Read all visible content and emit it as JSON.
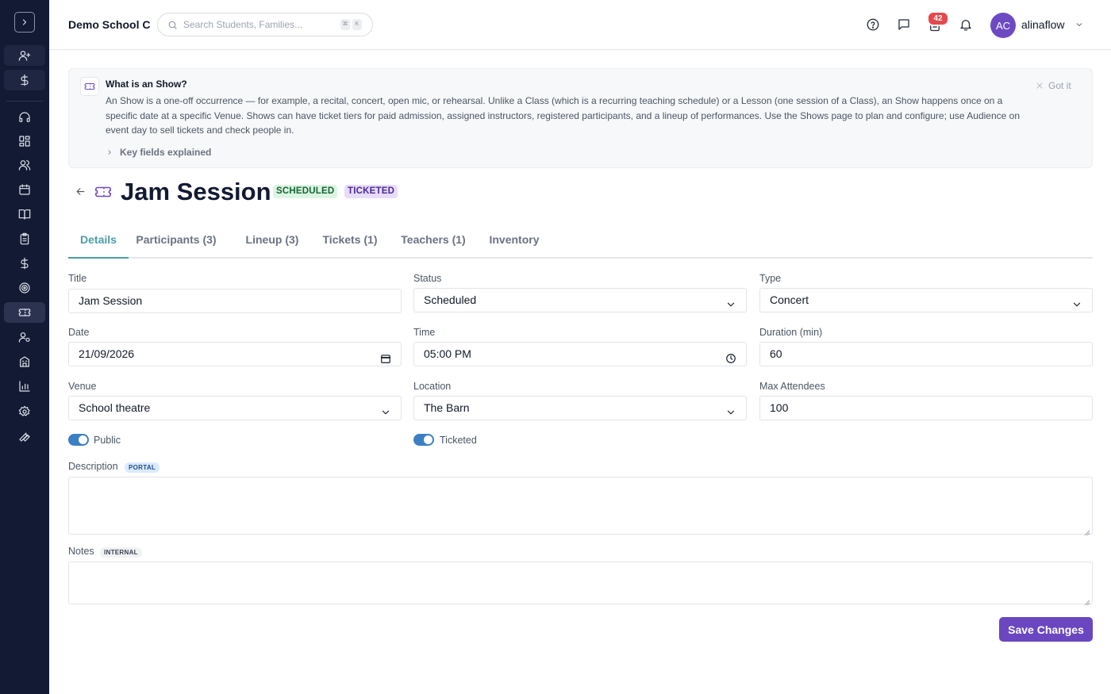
{
  "header": {
    "school_name": "Demo School C",
    "search_placeholder": "Search Students, Families...",
    "search_shortcut": [
      "⌘",
      "K"
    ],
    "notification_count": "42",
    "user_initials": "AC",
    "username": "alinaflow",
    "avatar_color": "#6d4ac4"
  },
  "sidebar": {
    "items": [
      "add-user",
      "billing",
      "support",
      "dashboard",
      "people",
      "calendar",
      "lessons",
      "assignments",
      "payments",
      "goals",
      "shows",
      "staff",
      "buildings",
      "reports",
      "settings",
      "tools"
    ],
    "active": "shows"
  },
  "banner": {
    "title": "What is an Show?",
    "text": "An Show is a one-off occurrence — for example, a recital, concert, open mic, or rehearsal. Unlike a Class (which is a recurring teaching schedule) or a Lesson (one session of a Class), an Show happens once on a specific date at a specific Venue. Shows can have ticket tiers for paid admission, assigned instructors, registered participants, and a lineup of performances. Use the Shows page to plan and configure; use Audience on event day to sell tickets and check people in.",
    "dismiss_label": "Got it",
    "key_fields_label": "Key fields explained"
  },
  "page": {
    "title": "Jam Session",
    "status_badge": "SCHEDULED",
    "ticketed_badge": "TICKETED"
  },
  "tabs": [
    {
      "label": "Details",
      "active": true
    },
    {
      "label": "Participants (3)",
      "active": false
    },
    {
      "label": "Lineup (3)",
      "active": false
    },
    {
      "label": "Tickets (1)",
      "active": false
    },
    {
      "label": "Teachers (1)",
      "active": false
    },
    {
      "label": "Inventory",
      "active": false
    }
  ],
  "form": {
    "title": {
      "label": "Title",
      "value": "Jam Session"
    },
    "status": {
      "label": "Status",
      "value": "Scheduled"
    },
    "type": {
      "label": "Type",
      "value": "Concert"
    },
    "date": {
      "label": "Date",
      "value": "21/09/2026"
    },
    "time": {
      "label": "Time",
      "value": "05:00 PM"
    },
    "duration": {
      "label": "Duration (min)",
      "value": "60"
    },
    "venue": {
      "label": "Venue",
      "value": "School theatre"
    },
    "location": {
      "label": "Location",
      "value": "The Barn"
    },
    "max_attendees": {
      "label": "Max Attendees",
      "value": "100"
    },
    "public": {
      "label": "Public",
      "on": true
    },
    "ticketed": {
      "label": "Ticketed",
      "on": true
    },
    "description": {
      "label": "Description",
      "tag": "PORTAL",
      "value": ""
    },
    "notes": {
      "label": "Notes",
      "tag": "INTERNAL",
      "value": ""
    }
  },
  "actions": {
    "save_label": "Save Changes"
  },
  "colors": {
    "sidebar_bg": "#131a33",
    "accent_teal": "#4a9da6",
    "primary_purple": "#6a47c0",
    "toggle_blue": "#3b7fc4"
  }
}
